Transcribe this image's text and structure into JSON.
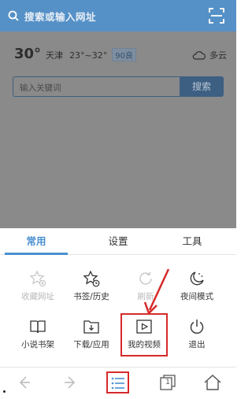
{
  "topbar": {
    "search_text": "搜索或输入网址",
    "scan_icon": "scan-icon"
  },
  "home": {
    "temperature": "30°",
    "city": "天津",
    "temp_range": "23°~32°",
    "aqi": "90良",
    "condition": "多云",
    "search_placeholder": "输入关键词",
    "search_button": "搜索"
  },
  "menu": {
    "tabs": [
      {
        "label": "常用",
        "active": true
      },
      {
        "label": "设置",
        "active": false
      },
      {
        "label": "工具",
        "active": false
      }
    ],
    "items": [
      {
        "label": "收藏网址",
        "icon": "star-add-icon",
        "disabled": true
      },
      {
        "label": "书签/历史",
        "icon": "bookmark-history-icon",
        "disabled": false
      },
      {
        "label": "刷新",
        "icon": "refresh-icon",
        "disabled": true
      },
      {
        "label": "夜间模式",
        "icon": "night-mode-icon",
        "disabled": false
      },
      {
        "label": "小说书架",
        "icon": "book-icon",
        "disabled": false
      },
      {
        "label": "下载/应用",
        "icon": "download-icon",
        "disabled": false
      },
      {
        "label": "我的视频",
        "icon": "video-icon",
        "disabled": false
      },
      {
        "label": "退出",
        "icon": "power-icon",
        "disabled": false
      }
    ]
  },
  "toolbar": {
    "tab_count": "1",
    "buttons": [
      "back-icon",
      "forward-icon",
      "menu-icon",
      "tabs-icon",
      "home-icon"
    ]
  },
  "colors": {
    "topbar": "#5591c7",
    "accent": "#4a90d0",
    "highlight": "#d62a2a"
  }
}
